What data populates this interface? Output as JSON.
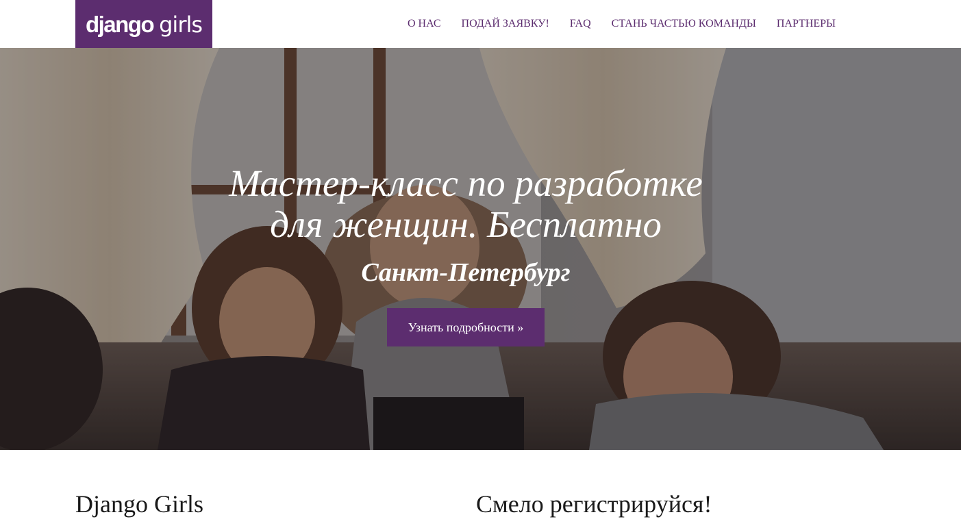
{
  "header": {
    "logo": {
      "bold": "django",
      "light": "girls"
    },
    "nav": [
      {
        "label": "О НАС"
      },
      {
        "label": "ПОДАЙ ЗАЯВКУ!"
      },
      {
        "label": "FAQ"
      },
      {
        "label": "СТАНЬ ЧАСТЬЮ КОМАНДЫ"
      },
      {
        "label": "ПАРТНЕРЫ"
      }
    ]
  },
  "hero": {
    "title_line1": "Мастер-класс по разработке",
    "title_line2": "для женщин. Бесплатно",
    "city": "Санкт-Петербург",
    "cta_label": "Узнать подробности »"
  },
  "sections": {
    "left_heading": "Django Girls",
    "right_heading": "Смело регистрируйся!"
  },
  "colors": {
    "brand": "#5c2d6f",
    "nav_text": "#5c2d6f",
    "hero_text": "#ffffff",
    "body_text": "#1a1a1a"
  }
}
